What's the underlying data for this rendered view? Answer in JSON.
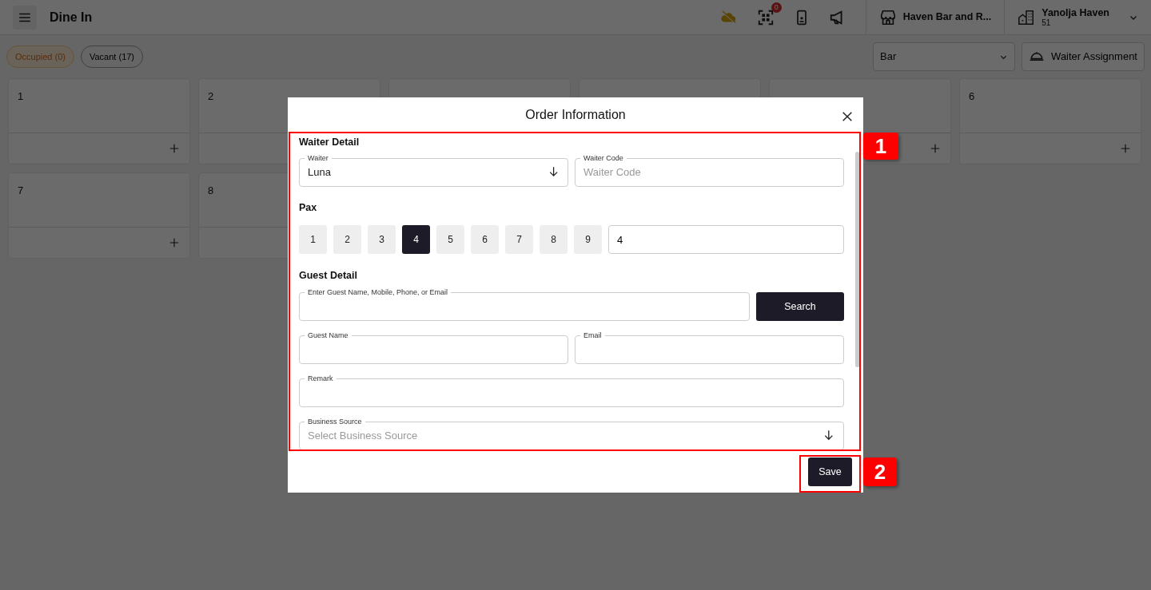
{
  "app_bar": {
    "title": "Dine In",
    "notification_count": "0",
    "outlet": "Haven Bar and R...",
    "property": {
      "name": "Yanolja Haven",
      "code": "51"
    }
  },
  "filters": [
    {
      "label": "Occupied (0)",
      "kind": "occupied"
    },
    {
      "label": "Vacant (17)",
      "kind": "vacant"
    }
  ],
  "area_select": {
    "value": "Bar"
  },
  "waiter_assignment_button": "Waiter Assignment",
  "tables": [
    {
      "number": "1"
    },
    {
      "number": "2"
    },
    {
      "kind": "covered"
    },
    {
      "kind": "covered"
    },
    {
      "kind": "covered"
    },
    {
      "number": "6"
    },
    {
      "number": "7"
    },
    {
      "number": "8"
    }
  ],
  "dialog": {
    "title": "Order Information",
    "waiter_detail": {
      "heading": "Waiter Detail",
      "waiter": {
        "label": "Waiter",
        "value": "Luna"
      },
      "waiter_code": {
        "label": "Waiter Code",
        "placeholder": "Waiter Code"
      }
    },
    "pax": {
      "heading": "Pax",
      "value": "4",
      "options": [
        {
          "label": "1",
          "selected": false
        },
        {
          "label": "2",
          "selected": false
        },
        {
          "label": "3",
          "selected": false
        },
        {
          "label": "4",
          "selected": true
        },
        {
          "label": "5",
          "selected": false
        },
        {
          "label": "6",
          "selected": false
        },
        {
          "label": "7",
          "selected": false
        },
        {
          "label": "8",
          "selected": false
        },
        {
          "label": "9",
          "selected": false
        }
      ]
    },
    "guest_detail": {
      "heading": "Guest Detail",
      "search_field": {
        "label": "Enter Guest Name, Mobile, Phone, or Email"
      },
      "search_button": "Search",
      "guest_name": {
        "label": "Guest Name"
      },
      "email": {
        "label": "Email"
      },
      "remark": {
        "label": "Remark"
      },
      "business_source": {
        "label": "Business Source",
        "placeholder": "Select Business Source"
      }
    },
    "save_button": "Save"
  },
  "callouts": [
    {
      "label": "1"
    },
    {
      "label": "2"
    }
  ]
}
